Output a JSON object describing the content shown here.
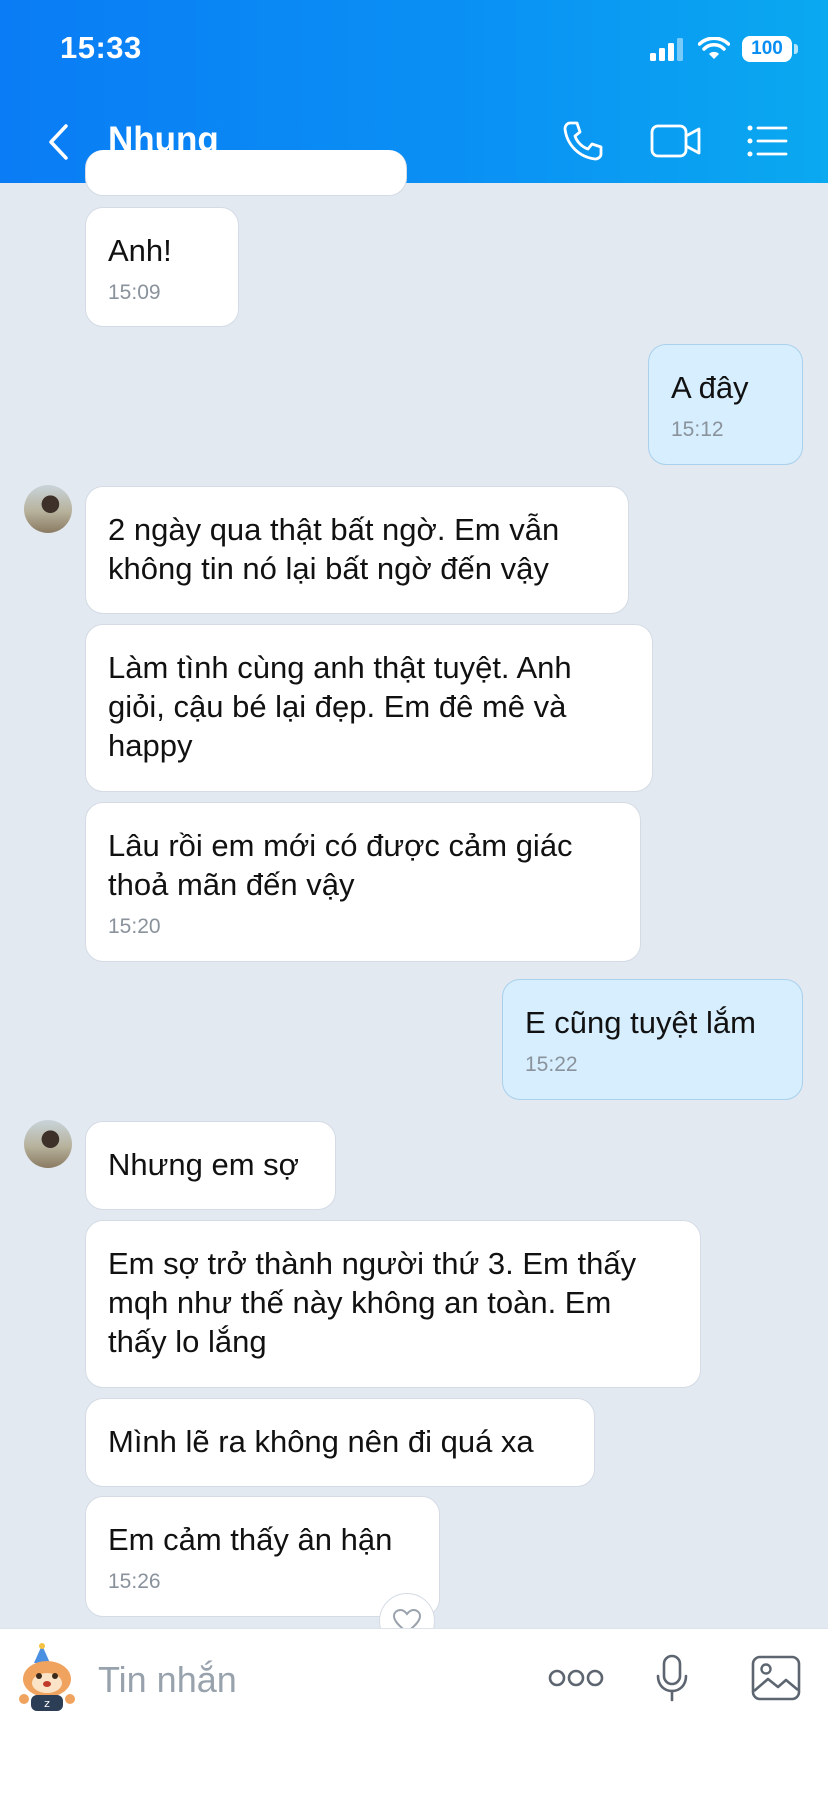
{
  "status_bar": {
    "time": "15:33",
    "battery": "100"
  },
  "header": {
    "contact_name": "Nhung"
  },
  "icons": {
    "back": "chevron-left-icon",
    "call": "phone-icon",
    "video": "video-camera-icon",
    "menu": "list-icon",
    "signal": "cellular-signal-icon",
    "wifi": "wifi-icon",
    "more": "more-dots-icon",
    "mic": "microphone-icon",
    "image": "image-icon",
    "sticker": "sticker-icon",
    "reaction": "heart-icon"
  },
  "messages": [
    {
      "from": "them",
      "text": "Anh!",
      "time": "15:09"
    },
    {
      "from": "me",
      "text": "A đây",
      "time": "15:12"
    },
    {
      "from": "them",
      "text": "2 ngày qua thật bất ngờ. Em vẫn không tin nó lại bất ngờ đến vậy"
    },
    {
      "from": "them",
      "text": "Làm tình cùng anh thật tuyệt. Anh giỏi, cậu bé lại đẹp. Em đê mê và happy"
    },
    {
      "from": "them",
      "text": "Lâu rồi em mới có được cảm giác thoả mãn đến vậy",
      "time": "15:20"
    },
    {
      "from": "me",
      "text": "E cũng tuyệt lắm",
      "time": "15:22"
    },
    {
      "from": "them",
      "text": "Nhưng em sợ"
    },
    {
      "from": "them",
      "text": "Em sợ trở thành người thứ 3. Em thấy mqh như thế này không an toàn. Em thấy lo lắng"
    },
    {
      "from": "them",
      "text": "Mình lẽ ra không nên đi quá xa"
    },
    {
      "from": "them",
      "text": "Em cảm thấy ân hận",
      "time": "15:26"
    }
  ],
  "composer": {
    "placeholder": "Tin nhắn"
  },
  "colors": {
    "header_start": "#0a7cf5",
    "header_end": "#0aa9f0",
    "chat_bg": "#e2e9f1",
    "my_bubble": "#d6eefe",
    "their_bubble": "#ffffff"
  }
}
